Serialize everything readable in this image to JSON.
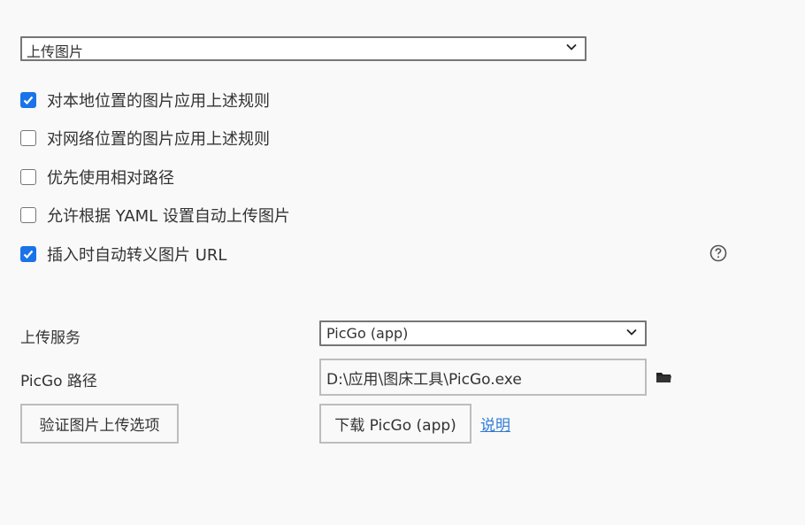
{
  "upload_action": {
    "selected": "上传图片"
  },
  "options": [
    {
      "label": "对本地位置的图片应用上述规则",
      "checked": true
    },
    {
      "label": "对网络位置的图片应用上述规则",
      "checked": false
    },
    {
      "label": "优先使用相对路径",
      "checked": false
    },
    {
      "label": "允许根据 YAML 设置自动上传图片",
      "checked": false
    },
    {
      "label": "插入时自动转义图片 URL",
      "checked": true
    }
  ],
  "help_icon": "question-circle-icon",
  "service": {
    "label": "上传服务",
    "selected": "PicGo (app)"
  },
  "picgo_path": {
    "label": "PicGo 路径",
    "value": "D:\\应用\\图床工具\\PicGo.exe",
    "browse_icon": "folder-icon"
  },
  "buttons": {
    "validate": "验证图片上传选项",
    "download": "下载 PicGo (app)",
    "help_link": "说明"
  },
  "colors": {
    "checkbox_checked": "#1a73e8",
    "link": "#2f7cd6",
    "background": "#f9f9f9"
  }
}
